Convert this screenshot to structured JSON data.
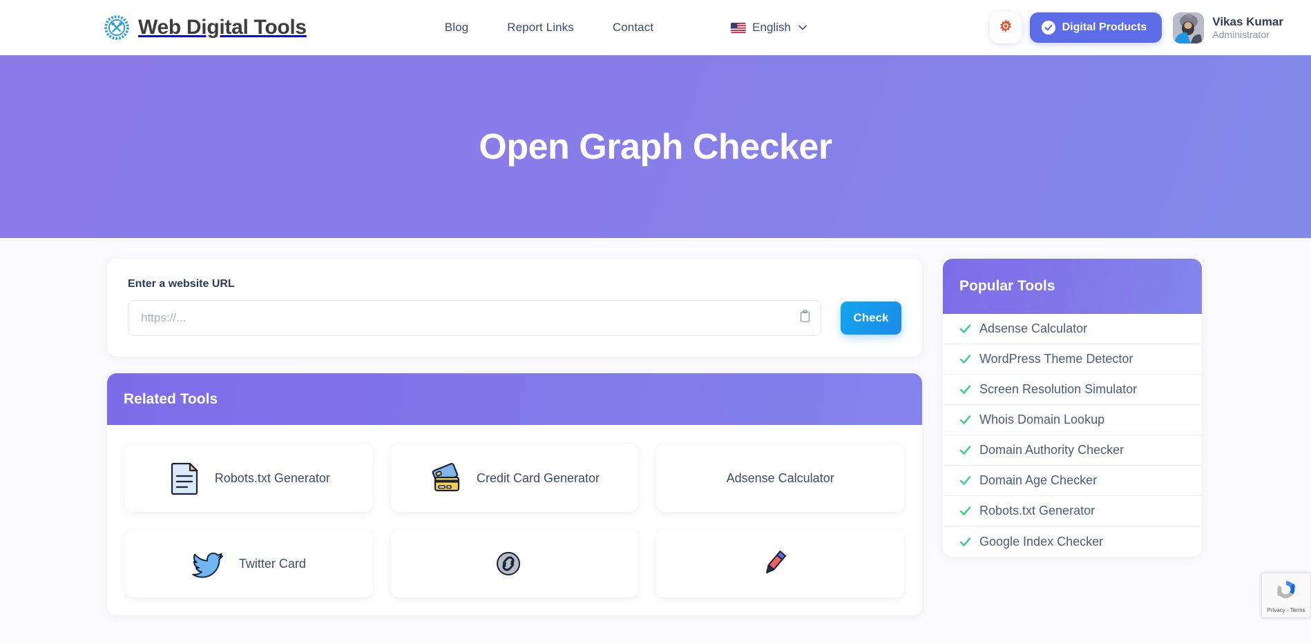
{
  "header": {
    "brand": "Web Digital Tools",
    "brand_icon": "gear-tools-logo-icon",
    "nav": [
      {
        "label": "Blog"
      },
      {
        "label": "Report Links"
      },
      {
        "label": "Contact"
      }
    ],
    "language": {
      "label": "English",
      "flag_icon": "us-flag-icon",
      "caret_icon": "chevron-down-icon"
    },
    "settings_icon": "gear-icon",
    "settings_icon_color": "#e8502f",
    "digital_products": {
      "label": "Digital Products",
      "icon": "check-circle-icon",
      "color": "#5c6ce6"
    },
    "user": {
      "name": "Vikas Kumar",
      "role": "Administrator",
      "avatar_icon": "user-avatar"
    }
  },
  "hero": {
    "title": "Open Graph Checker",
    "gradient_from": "#8b7ae8",
    "gradient_to": "#8089e8"
  },
  "url_form": {
    "label": "Enter a website URL",
    "placeholder": "https://...",
    "value": "",
    "paste_icon": "clipboard-icon",
    "submit_label": "Check",
    "submit_color": "#17a2ef"
  },
  "related": {
    "title": "Related Tools",
    "tools": [
      {
        "label": "Robots.txt Generator",
        "icon": "document-icon"
      },
      {
        "label": "Credit Card Generator",
        "icon": "credit-card-icon"
      },
      {
        "label": "Adsense Calculator",
        "icon": "none"
      },
      {
        "label": "Twitter Card",
        "icon": "twitter-bird-icon"
      },
      {
        "label": "",
        "icon": "link-chain-icon"
      },
      {
        "label": "",
        "icon": "pen-icon"
      }
    ]
  },
  "popular": {
    "title": "Popular Tools",
    "check_color": "#3ecf8e",
    "items": [
      {
        "label": "Adsense Calculator"
      },
      {
        "label": "WordPress Theme Detector"
      },
      {
        "label": "Screen Resolution Simulator"
      },
      {
        "label": "Whois Domain Lookup"
      },
      {
        "label": "Domain Authority Checker"
      },
      {
        "label": "Domain Age Checker"
      },
      {
        "label": "Robots.txt Generator"
      },
      {
        "label": "Google Index Checker"
      }
    ]
  },
  "recaptcha": {
    "text": "Privacy - Terms",
    "icon": "recaptcha-icon"
  }
}
